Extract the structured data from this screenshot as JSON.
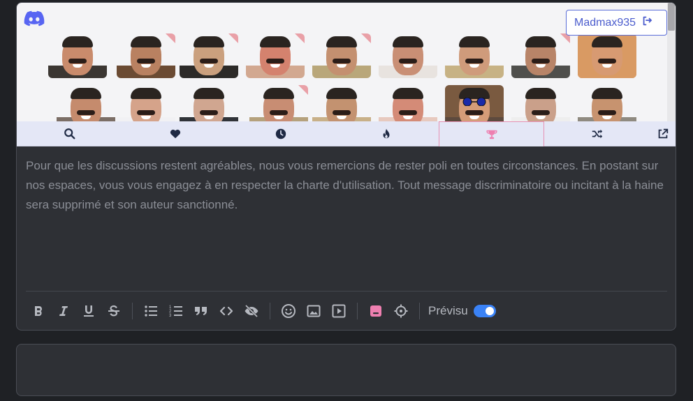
{
  "header": {
    "username": "Madmax935",
    "discord_icon": "discord-logo-icon",
    "logout_icon": "sign-out-icon"
  },
  "stickers": [
    {
      "bg": "#f4f4f6",
      "skin": "#c98b6c",
      "torso": "#3b3632",
      "corner": false
    },
    {
      "bg": "#f4f4f6",
      "skin": "#b98161",
      "torso": "#6b4b33",
      "corner": true
    },
    {
      "bg": "#f4f4f6",
      "skin": "#caa07e",
      "torso": "#2c2a28",
      "corner": true
    },
    {
      "bg": "#f4f4f6",
      "skin": "#d4826e",
      "torso": "#d2a890",
      "corner": true
    },
    {
      "bg": "#f4f4f6",
      "skin": "#c49070",
      "torso": "#b9a77a",
      "corner": true
    },
    {
      "bg": "#f4f4f6",
      "skin": "#c98f75",
      "torso": "#e8e3df",
      "corner": false
    },
    {
      "bg": "#f4f4f6",
      "skin": "#cf9b7b",
      "torso": "#c7b284",
      "corner": false
    },
    {
      "bg": "#f4f4f6",
      "skin": "#b88468",
      "torso": "#4f4f4c",
      "corner": true
    },
    {
      "bg": "#d99a63",
      "skin": "#d79a72",
      "torso": "#d99a63",
      "corner": false
    },
    {
      "bg": "#f4f4f6",
      "skin": "#c58b6d",
      "torso": "#7b6e66",
      "corner": false
    },
    {
      "bg": "#f4f4f6",
      "skin": "#d5a38a",
      "torso": "#f1f1f4",
      "corner": false
    },
    {
      "bg": "#f4f4f6",
      "skin": "#d0a690",
      "torso": "#303338",
      "corner": false
    },
    {
      "bg": "#f4f4f6",
      "skin": "#c88d73",
      "torso": "#b5a17c",
      "corner": true
    },
    {
      "bg": "#f4f4f6",
      "skin": "#c39270",
      "torso": "#c8b088",
      "corner": false
    },
    {
      "bg": "#f4f4f6",
      "skin": "#d48b77",
      "torso": "#e7c9be",
      "corner": false
    },
    {
      "bg": "#7a5a40",
      "skin": "#d49c78",
      "torso": "#5d4a3e",
      "corner": false,
      "glasses": true
    },
    {
      "bg": "#f4f4f6",
      "skin": "#caa08a",
      "torso": "#eeeeee",
      "corner": false
    },
    {
      "bg": "#f4f4f6",
      "skin": "#c7936f",
      "torso": "#8f8a80",
      "corner": false
    }
  ],
  "tabs": [
    {
      "name": "tab-search",
      "icon": "search-icon"
    },
    {
      "name": "tab-favorites",
      "icon": "heart-icon"
    },
    {
      "name": "tab-recent",
      "icon": "clock-icon"
    },
    {
      "name": "tab-trending",
      "icon": "fire-icon"
    },
    {
      "name": "tab-top",
      "icon": "trophy-icon",
      "active": true
    },
    {
      "name": "tab-random",
      "icon": "shuffle-icon"
    },
    {
      "name": "tab-external",
      "icon": "external-link-icon"
    }
  ],
  "editor": {
    "message": "Pour que les discussions restent agréables, nous vous remercions de rester poli en toutes circonstances. En postant sur nos espaces, vous vous engagez à en respecter la charte d'utilisation. Tout message discriminatoire ou incitant à la haine sera supprimé et son auteur sanctionné."
  },
  "toolbar": {
    "groups": [
      [
        "bold-icon",
        "italic-icon",
        "underline-icon",
        "strikethrough-icon"
      ],
      [
        "bullet-list-icon",
        "numbered-list-icon",
        "quote-icon",
        "code-icon",
        "spoiler-eye-slash-icon"
      ],
      [
        "emoji-icon",
        "image-icon",
        "video-play-icon"
      ],
      [
        "sticker-icon",
        "settings-gear-icon"
      ]
    ],
    "preview_label": "Prévisu",
    "preview_enabled": true
  },
  "colors": {
    "accent": "#e791b3",
    "toggle": "#3a82f6",
    "link": "#4b5ccd"
  }
}
